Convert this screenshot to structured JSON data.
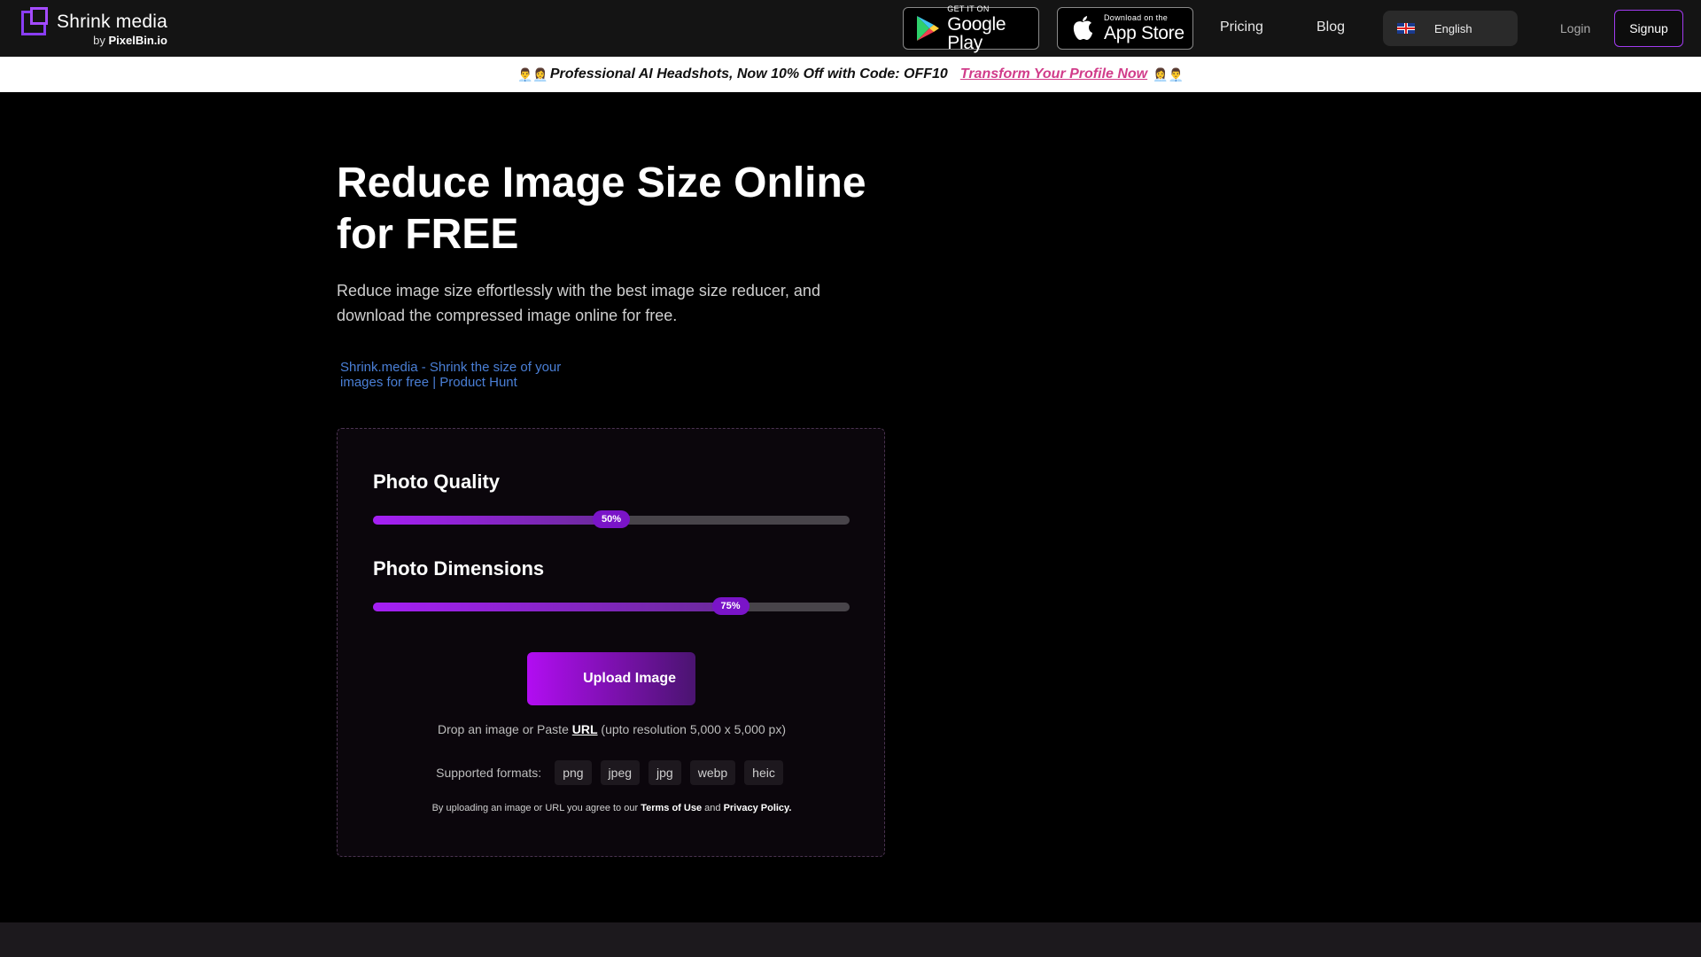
{
  "header": {
    "logo_title": "Shrink media",
    "logo_by": "by",
    "logo_by_brand": "PixelBin.io",
    "google_play_small": "GET IT ON",
    "google_play_big": "Google Play",
    "app_store_small": "Download on the",
    "app_store_big": "App Store",
    "nav_pricing": "Pricing",
    "nav_blog": "Blog",
    "language": "English",
    "login": "Login",
    "signup": "Signup"
  },
  "promo": {
    "emoji_left": "👨‍💼👩‍💼",
    "text": "Professional AI Headshots, Now 10% Off with Code: OFF10",
    "link": "Transform Your Profile Now",
    "emoji_right": "👩‍💼👨‍💼"
  },
  "hero": {
    "title": "Reduce Image Size Online for FREE",
    "description": "Reduce image size effortlessly with the best image size reducer, and download the compressed image online for free.",
    "product_hunt_alt": "Shrink.media - Shrink the size of your images for free | Product Hunt"
  },
  "tool": {
    "quality_title": "Photo Quality",
    "quality_value": 50,
    "quality_label": "50%",
    "dimensions_title": "Photo Dimensions",
    "dimensions_value": 75,
    "dimensions_label": "75%",
    "upload_label": "Upload Image",
    "drop_prefix": "Drop an image or Paste",
    "drop_url": "URL",
    "drop_suffix": "(upto resolution 5,000 x 5,000 px)",
    "formats_label": "Supported formats:",
    "formats": [
      "png",
      "jpeg",
      "jpg",
      "webp",
      "heic"
    ],
    "terms_prefix": "By uploading an image or URL you agree to our",
    "terms_link": "Terms of Use",
    "terms_and": "and",
    "privacy_link": "Privacy Policy."
  },
  "colors": {
    "accent": "#a51ff5",
    "promo_link": "#d13c8a",
    "product_hunt_link": "#4a7fd6"
  }
}
